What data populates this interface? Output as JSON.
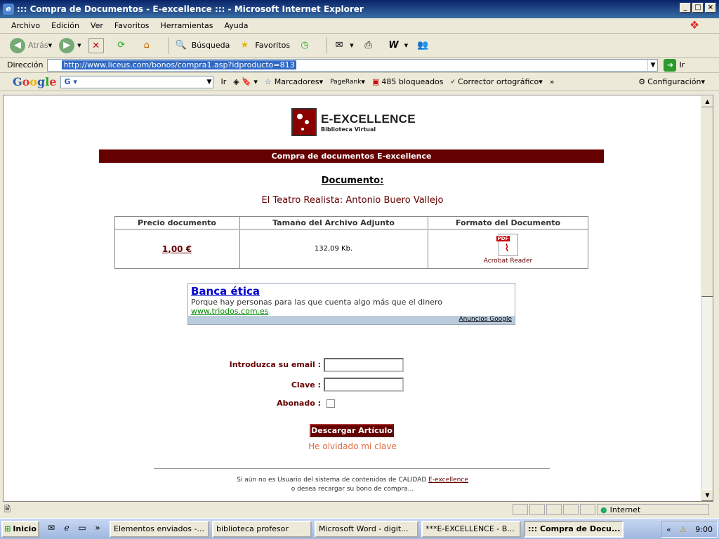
{
  "window": {
    "title": "::: Compra de Documentos - E-excellence ::: - Microsoft Internet Explorer"
  },
  "menu": [
    "Archivo",
    "Edición",
    "Ver",
    "Favoritos",
    "Herramientas",
    "Ayuda"
  ],
  "toolbar": {
    "back": "Atrás",
    "search": "Búsqueda",
    "favorites": "Favoritos"
  },
  "address": {
    "label": "Dirección",
    "url": "http://www.liceus.com/bonos/compra1.asp?idproducto=813",
    "go": "Ir"
  },
  "google_bar": {
    "go": "Ir",
    "bookmarks": "Marcadores",
    "pagerank": "PageRank",
    "blocked": "485 bloqueados",
    "spell": "Corrector ortográfico",
    "settings": "Configuración"
  },
  "page": {
    "logo_title": "E-EXCELLENCE",
    "logo_sub": "Biblioteca Virtual",
    "banner": "Compra de documentos E-excellence",
    "doc_label": "Documento:",
    "doc_title": "El Teatro Realista: Antonio Buero Vallejo",
    "table": {
      "headers": [
        "Precio documento",
        "Tamaño del Archivo Adjunto",
        "Formato del Documento"
      ],
      "price": "1,00 €",
      "size": "132,09 Kb.",
      "format": "Acrobat Reader",
      "pdf_tag": "PDF"
    },
    "ad": {
      "title": "Banca ética",
      "desc": "Porque hay personas para las que cuenta algo más que el dinero",
      "url": "www.triodos.com.es",
      "footer": "Anuncios Google"
    },
    "form": {
      "email_label": "Introduzca su email :",
      "password_label": "Clave :",
      "subscribed_label": "Abonado :",
      "button": "Descargar Artículo",
      "forgot": "He olvidado mi clave"
    },
    "footer_line1": "Si aún no es Usuario del sistema de contenidos de CALIDAD",
    "footer_link": "E-excellence",
    "footer_line2": "o desea recargar su bono de compra..."
  },
  "status": {
    "zone": "Internet"
  },
  "taskbar": {
    "start": "Inicio",
    "tasks": [
      "Elementos enviados -...",
      "biblioteca profesor",
      "Microsoft Word - digit...",
      "***E-EXCELLENCE - B...",
      "::: Compra de Docu..."
    ],
    "clock": "9:00"
  }
}
